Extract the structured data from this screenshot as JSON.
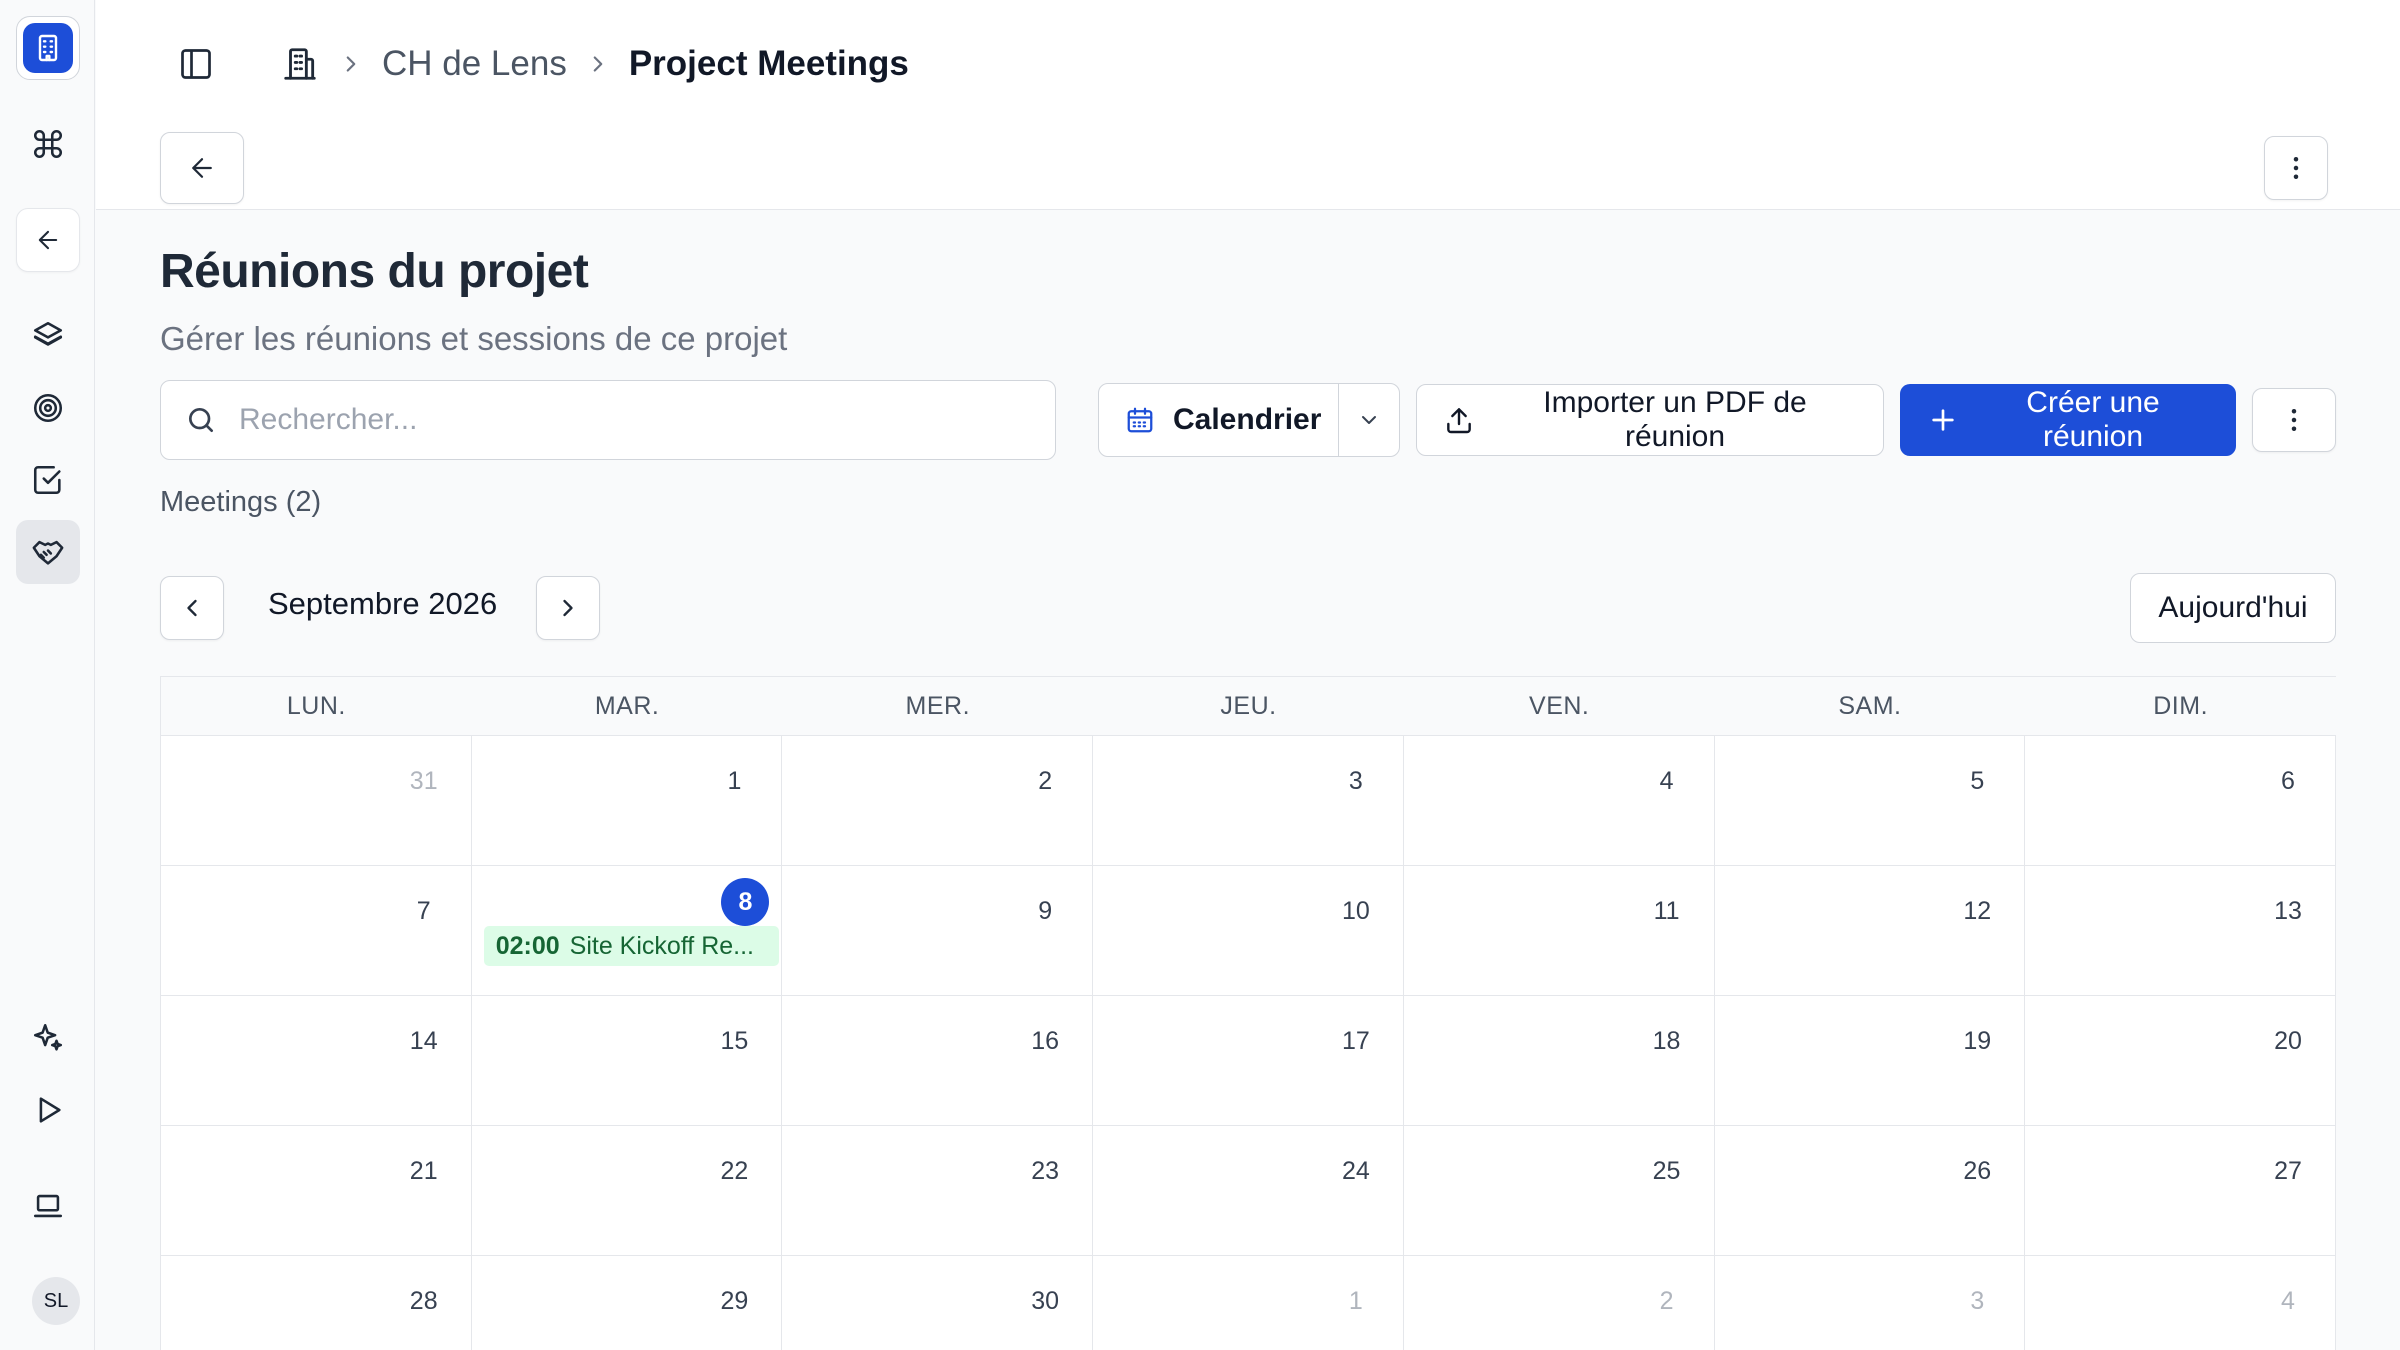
{
  "app": {
    "avatar_initials": "SL"
  },
  "header": {
    "breadcrumb": {
      "parent": "CH de Lens",
      "current": "Project Meetings"
    }
  },
  "page": {
    "title": "Réunions du projet",
    "subtitle": "Gérer les réunions et sessions de ce projet"
  },
  "toolbar": {
    "search_placeholder": "Rechercher...",
    "view_label": "Calendrier",
    "import_label": "Importer un PDF de réunion",
    "create_label": "Créer une réunion"
  },
  "meetings_count": "Meetings (2)",
  "calendar": {
    "month_label": "Septembre 2026",
    "today_label": "Aujourd'hui",
    "weekdays": [
      "LUN.",
      "MAR.",
      "MER.",
      "JEU.",
      "VEN.",
      "SAM.",
      "DIM."
    ],
    "weeks": [
      [
        {
          "day": "31",
          "muted": true
        },
        {
          "day": "1"
        },
        {
          "day": "2"
        },
        {
          "day": "3"
        },
        {
          "day": "4"
        },
        {
          "day": "5"
        },
        {
          "day": "6"
        }
      ],
      [
        {
          "day": "7"
        },
        {
          "day": "8",
          "today": true,
          "event": {
            "time": "02:00",
            "title": "Site Kickoff Re..."
          }
        },
        {
          "day": "9"
        },
        {
          "day": "10"
        },
        {
          "day": "11"
        },
        {
          "day": "12"
        },
        {
          "day": "13"
        }
      ],
      [
        {
          "day": "14"
        },
        {
          "day": "15"
        },
        {
          "day": "16"
        },
        {
          "day": "17"
        },
        {
          "day": "18"
        },
        {
          "day": "19"
        },
        {
          "day": "20"
        }
      ],
      [
        {
          "day": "21"
        },
        {
          "day": "22"
        },
        {
          "day": "23"
        },
        {
          "day": "24"
        },
        {
          "day": "25"
        },
        {
          "day": "26"
        },
        {
          "day": "27"
        }
      ],
      [
        {
          "day": "28"
        },
        {
          "day": "29"
        },
        {
          "day": "30"
        },
        {
          "day": "1",
          "muted": true
        },
        {
          "day": "2",
          "muted": true
        },
        {
          "day": "3",
          "muted": true
        },
        {
          "day": "4",
          "muted": true
        }
      ]
    ]
  },
  "colors": {
    "accent": "#1d4ed8",
    "event_bg": "#dcfce7",
    "event_text": "#166534"
  }
}
